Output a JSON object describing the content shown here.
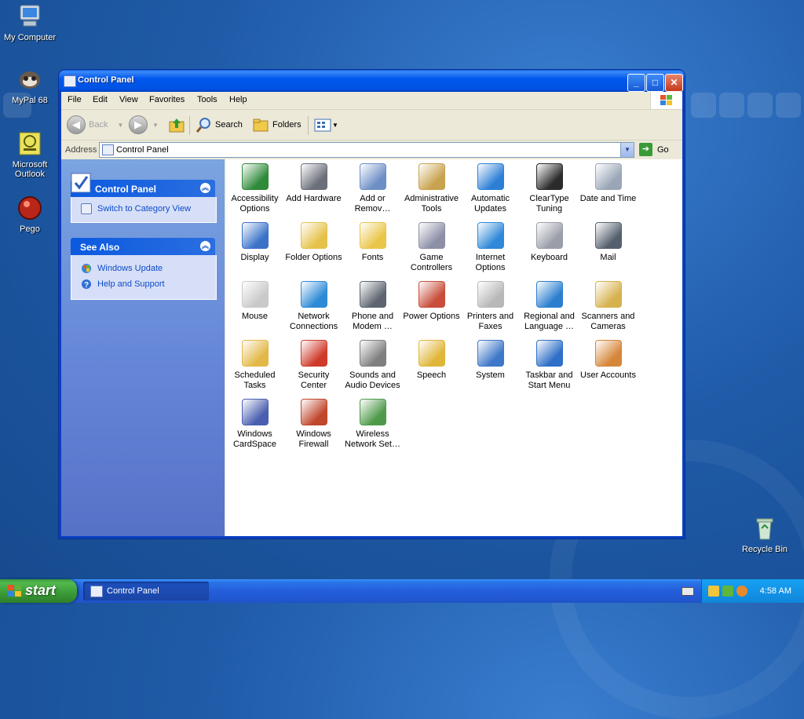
{
  "desktop": {
    "icons": [
      {
        "label": "My Computer"
      },
      {
        "label": "MyPal 68"
      },
      {
        "label": "Microsoft Outlook"
      },
      {
        "label": "Pego"
      },
      {
        "label": "Recycle Bin"
      }
    ]
  },
  "window": {
    "title": "Control Panel",
    "menu": [
      "File",
      "Edit",
      "View",
      "Favorites",
      "Tools",
      "Help"
    ],
    "toolbar": {
      "back": "Back",
      "search": "Search",
      "folders": "Folders"
    },
    "address": {
      "label": "Address",
      "value": "Control Panel",
      "go": "Go"
    },
    "taskpane": {
      "control_panel": {
        "title": "Control Panel",
        "link": "Switch to Category View"
      },
      "see_also": {
        "title": "See Also",
        "links": [
          "Windows Update",
          "Help and Support"
        ]
      }
    },
    "items": [
      {
        "label": "Accessibility Options",
        "color": "#2f8a3a"
      },
      {
        "label": "Add Hardware",
        "color": "#6a6f7a"
      },
      {
        "label": "Add or Remov…",
        "color": "#6e8fc6"
      },
      {
        "label": "Administrative Tools",
        "color": "#c8a24e"
      },
      {
        "label": "Automatic Updates",
        "color": "#2d7fd6"
      },
      {
        "label": "ClearType Tuning",
        "color": "#2b2b2b"
      },
      {
        "label": "Date and Time",
        "color": "#9aa6b8"
      },
      {
        "label": "Display",
        "color": "#3b72c8"
      },
      {
        "label": "Folder Options",
        "color": "#e6c24b"
      },
      {
        "label": "Fonts",
        "color": "#e9c649"
      },
      {
        "label": "Game Controllers",
        "color": "#8c8fa6"
      },
      {
        "label": "Internet Options",
        "color": "#2f88d8"
      },
      {
        "label": "Keyboard",
        "color": "#9a9ea8"
      },
      {
        "label": "Mail",
        "color": "#55606e"
      },
      {
        "label": "Mouse",
        "color": "#c9c9c9"
      },
      {
        "label": "Network Connections",
        "color": "#2c8ad6"
      },
      {
        "label": "Phone and Modem …",
        "color": "#5e6570"
      },
      {
        "label": "Power Options",
        "color": "#c84d3a"
      },
      {
        "label": "Printers and Faxes",
        "color": "#b8b8b8"
      },
      {
        "label": "Regional and Language …",
        "color": "#2c7fcf"
      },
      {
        "label": "Scanners and Cameras",
        "color": "#d6b24f"
      },
      {
        "label": "Scheduled Tasks",
        "color": "#e2b848"
      },
      {
        "label": "Security Center",
        "color": "#cf3b2b"
      },
      {
        "label": "Sounds and Audio Devices",
        "color": "#7f7f7f"
      },
      {
        "label": "Speech",
        "color": "#e0b63a"
      },
      {
        "label": "System",
        "color": "#3f78c8"
      },
      {
        "label": "Taskbar and Start Menu",
        "color": "#2f6fc8"
      },
      {
        "label": "User Accounts",
        "color": "#d6863a"
      },
      {
        "label": "Windows CardSpace",
        "color": "#4a5fb0"
      },
      {
        "label": "Windows Firewall",
        "color": "#c0462c"
      },
      {
        "label": "Wireless Network Set…",
        "color": "#4e9a4a"
      }
    ]
  },
  "taskbar": {
    "start": "start",
    "task": "Control Panel",
    "clock": "4:58 AM"
  }
}
